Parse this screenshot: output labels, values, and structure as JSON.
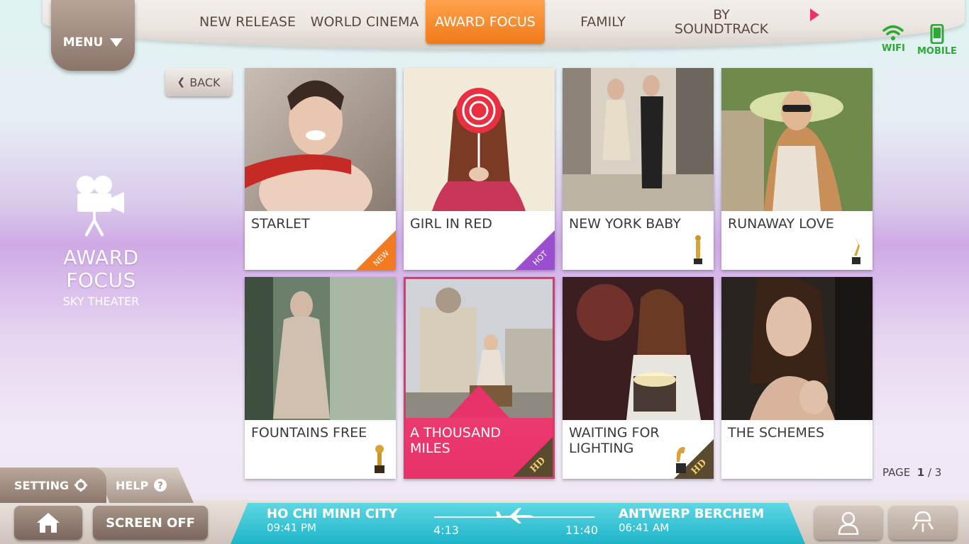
{
  "nav": {
    "menu_label": "MENU",
    "tabs": [
      {
        "label": "NEW RELEASE",
        "active": false
      },
      {
        "label": "WORLD CINEMA",
        "active": false
      },
      {
        "label": "AWARD FOCUS",
        "active": true
      },
      {
        "label": "FAMILY",
        "active": false
      },
      {
        "label": "BY SOUNDTRACK",
        "active": false
      }
    ],
    "wifi_label": "WIFI",
    "mobile_label": "MOBILE"
  },
  "back_label": "BACK",
  "section": {
    "title_line1": "AWARD",
    "title_line2": "FOCUS",
    "subtitle": "SKY THEATER",
    "icon": "movie-camera-icon"
  },
  "movies": [
    {
      "title": "STARLET",
      "badge": "NEW",
      "badge_color": "#f27a20"
    },
    {
      "title": "GIRL IN RED",
      "badge": "HOT",
      "badge_color": "#9b4fd0"
    },
    {
      "title": "NEW YORK BABY",
      "award": "oscar-statue-icon"
    },
    {
      "title": "RUNAWAY LOVE",
      "award": "dancer-trophy-icon"
    },
    {
      "title": "FOUNTAINS FREE",
      "award": "globe-trophy-icon"
    },
    {
      "title": "A THOUSAND MILES",
      "badge": "HD",
      "selected": true
    },
    {
      "title": "WAITING FOR LIGHTING",
      "badge": "HD",
      "award": "horse-trophy-icon"
    },
    {
      "title": "THE SCHEMES"
    }
  ],
  "pagination": {
    "label": "PAGE",
    "current": "1",
    "total": "/ 3"
  },
  "bottom": {
    "setting_label": "SETTING",
    "help_label": "HELP",
    "screen_off_label": "SCREEN OFF",
    "flight": {
      "origin_city": "HO CHI MINH CITY",
      "origin_time": "09:41 PM",
      "dest_city": "ANTWERP BERCHEM",
      "dest_time": "06:41 AM",
      "elapsed": "4:13",
      "total": "11:40"
    }
  },
  "colors": {
    "accent": "#f07a18",
    "selected": "#e8326a",
    "brown": "#8b756a",
    "teal": "#1eb4c8",
    "status_green": "#2ea836"
  }
}
